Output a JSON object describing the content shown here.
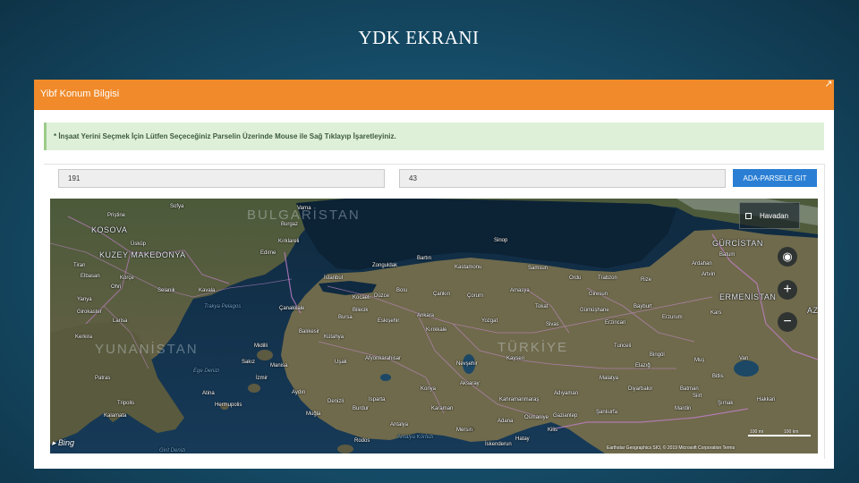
{
  "slide": {
    "title": "YDK EKRANI"
  },
  "panel": {
    "title": "Yibf Konum Bilgisi",
    "close_symbol": "↗",
    "alert_text": "* İnşaat Yerini Seçmek İçin Lütfen Seçeceğiniz Parselin Üzerinde Mouse ile Sağ Tıklayıp İşaretleyiniz.",
    "ada_value": "191",
    "parsel_value": "43",
    "go_button_label": "ADA-PARSELE GIT"
  },
  "map": {
    "layer_toggle_label": "Havadan",
    "bing_label": "Bing",
    "scale_labels": [
      "100 mi",
      "100 km"
    ],
    "copyright": "Earthstar Geographics SIO, © 2019 Microsoft Corporation Terms",
    "icons": [
      "locate-icon",
      "zoom-in-icon",
      "zoom-out-icon",
      "checkbox-icon",
      "bing-logo-icon"
    ],
    "country_labels": [
      "KOSOVA",
      "KUZEY MAKEDONYA",
      "YUNANİSTAN",
      "GÜRCİSTAN",
      "ERMENİSTAN",
      "AZ",
      "BULGARİSTAN",
      "TÜRKİYE"
    ],
    "sea_labels": [
      "Ege Denizi",
      "Trakya Pelagos",
      "Antalya Körfezi",
      "Girit Denizi"
    ],
    "city_labels": [
      "Sofya",
      "Priştine",
      "Üsküp",
      "Selanik",
      "Kavala",
      "Edirne",
      "Kırklareli",
      "Burgaz",
      "Varna",
      "Sinop",
      "Samsun",
      "Ordu",
      "Trabzon",
      "Rize",
      "Artvin",
      "Batum",
      "Zonguldak",
      "Bartın",
      "Kastamonu",
      "İstanbul",
      "Kocaeli",
      "Düzce",
      "Bolu",
      "Çankırı",
      "Çorum",
      "Amasya",
      "Tokat",
      "Giresun",
      "Gümüşhane",
      "Bayburt",
      "Erzurum",
      "Erzincan",
      "Kars",
      "Ardahan",
      "Bursa",
      "Bilecik",
      "Eskişehir",
      "Ankara",
      "Kırıkkale",
      "Yozgat",
      "Sivas",
      "Kayseri",
      "Nevşehir",
      "Aksaray",
      "Konya",
      "Karaman",
      "Mersin",
      "Adana",
      "Osmaniye",
      "Gaziantep",
      "Şanlıurfa",
      "Kilis",
      "Hatay",
      "İskenderun",
      "Kahramanmaraş",
      "Adıyaman",
      "Malatya",
      "Elazığ",
      "Tunceli",
      "Bingöl",
      "Muş",
      "Bitlis",
      "Batman",
      "Siirt",
      "Mardin",
      "Şırnak",
      "Diyarbakır",
      "Van",
      "Hakkari",
      "Manisa",
      "İzmir",
      "Aydın",
      "Denizli",
      "Muğla",
      "Isparta",
      "Burdur",
      "Antalya",
      "Uşak",
      "Afyonkarahisar",
      "Kütahya",
      "Balıkesir",
      "Çanakkale",
      "Atina",
      "Patras",
      "Larisa",
      "Yanya",
      "Tiran",
      "Elbasan",
      "Ohri",
      "Korçe",
      "Girokaster",
      "Kerkira",
      "Midilli",
      "Sakız",
      "Hermupolis",
      "Rodos",
      "Tripolis",
      "Kalamata"
    ]
  }
}
